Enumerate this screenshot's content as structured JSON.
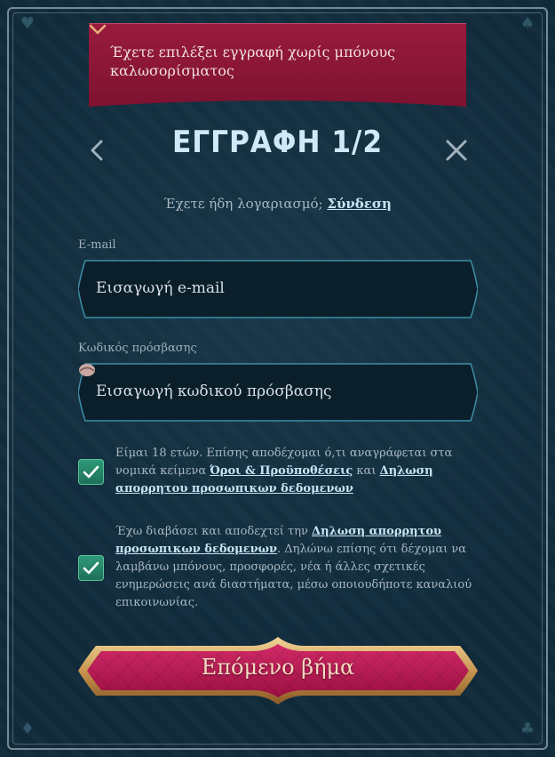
{
  "banner": {
    "text": "Έχετε επιλέξει εγγραφή χωρίς μπόνους καλωσορίσματος",
    "icon": "chevron-down-icon",
    "color": "#8f1736"
  },
  "header": {
    "title": "ΕΓΓΡΑΦΗ 1/2",
    "back_icon": "chevron-left-icon",
    "close_icon": "close-icon"
  },
  "login": {
    "prompt": "Έχετε ήδη λογαριασμό;",
    "link": "Σύνδεση"
  },
  "email": {
    "label": "E-mail",
    "placeholder": "Εισαγωγή e-mail"
  },
  "password": {
    "label": "Κωδικός πρόσβασης",
    "placeholder": "Εισαγωγή κωδικού πρόσβασης",
    "icon": "eye-icon"
  },
  "consent_terms": {
    "checked": true,
    "text_before": "Είμαι 18 ετών. Επίσης αποδέχομαι ό,τι αναγράφεται στα νομικά κείμενα ",
    "link_terms": "Όροι & Προϋποθέσεις",
    "text_middle": " και ",
    "link_privacy": "Δηλωση απορρητου προσωπικων δεδομενων"
  },
  "consent_marketing": {
    "checked": true,
    "text_before": "Έχω διαβάσει και αποδεχτεί την ",
    "link_privacy": "Δηλωση απορρητου προσωπικων δεδομενων",
    "text_after": ". Δηλώνω επίσης ότι δέχομαι να λαμβάνω μπόνους, προσφορές, νέα ή άλλες σχετικές ενημερώσεις ανά διαστήματα, μέσω οποιουδήποτε καναλιού επικοινωνίας."
  },
  "next_button": {
    "label": "Επόμενο βήμα",
    "color": "#b4154f"
  },
  "decor_icons": [
    "heart-icon",
    "spade-icon",
    "diamond-icon",
    "club-icon"
  ]
}
